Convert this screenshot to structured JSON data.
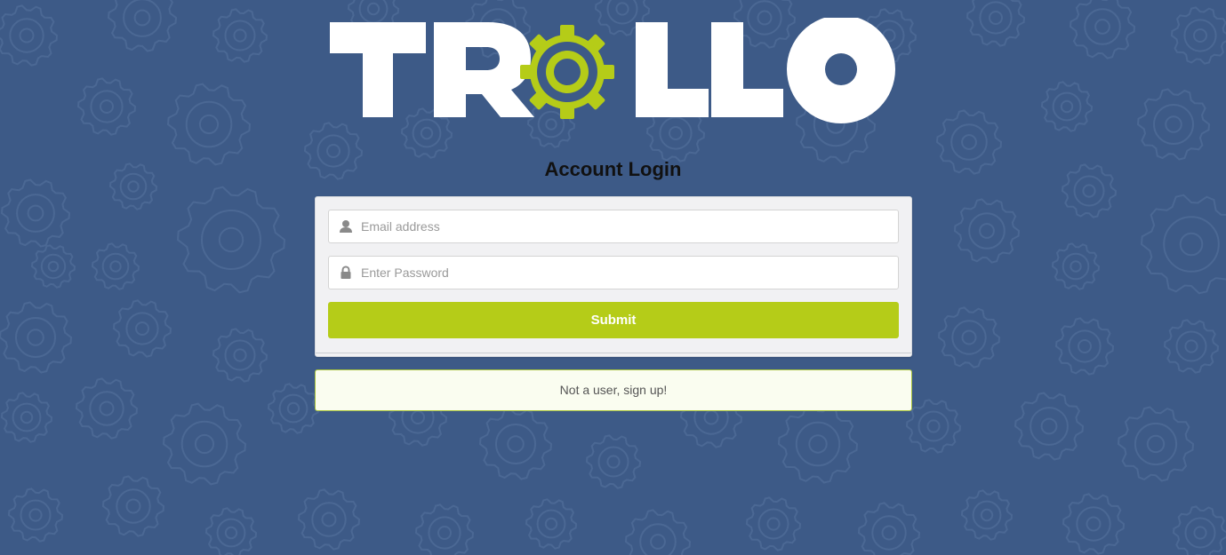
{
  "brand": {
    "logo_text": "TROLLO",
    "accent_color": "#b5cc18",
    "background_color": "#3d5a87"
  },
  "login": {
    "title": "Account Login",
    "email": {
      "placeholder": "Email address",
      "value": "",
      "icon": "user-icon"
    },
    "password": {
      "placeholder": "Enter Password",
      "value": "",
      "icon": "lock-icon"
    },
    "submit_label": "Submit"
  },
  "signup": {
    "message": "Not a user, sign up!"
  }
}
